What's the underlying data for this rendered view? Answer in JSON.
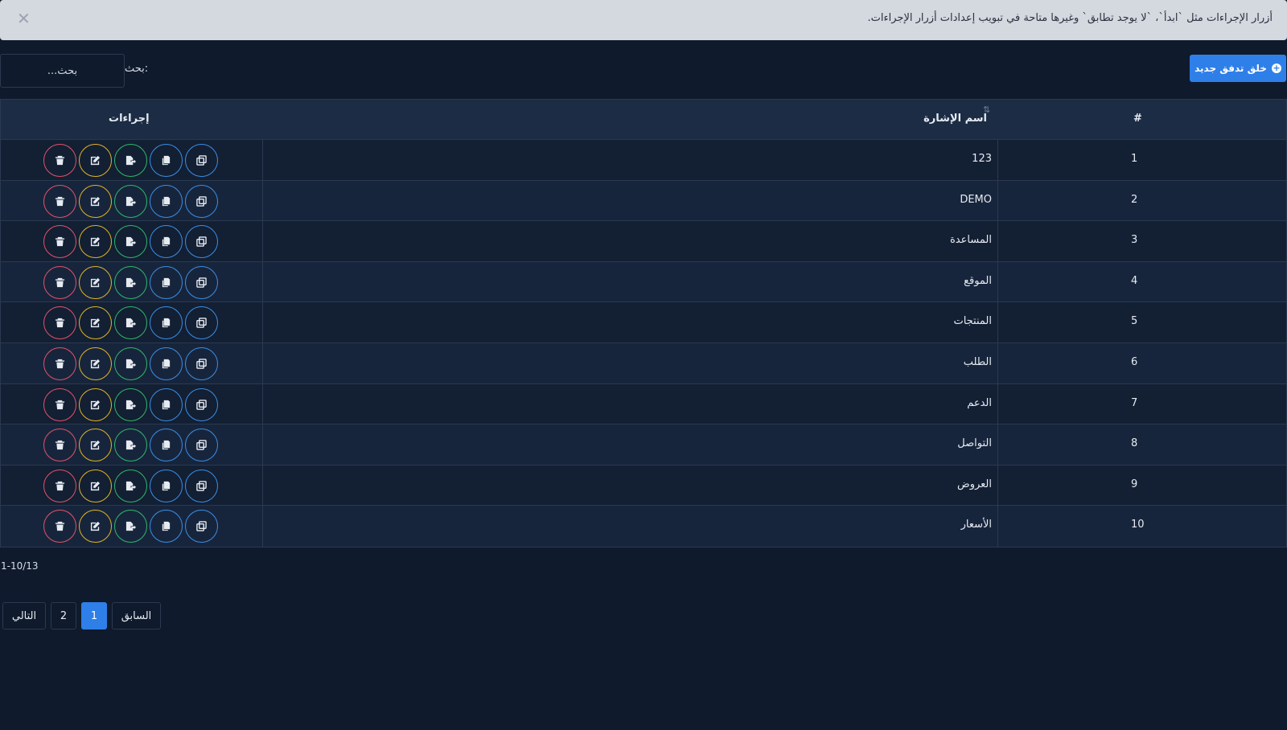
{
  "alert": {
    "text": "أزرار الإجراءات مثل `ابدأ`، `لا يوجد تطابق` وغيرها متاحة في تبويب إعدادات أزرار الإجراءات.",
    "close": "✕"
  },
  "toolbar": {
    "create_label": "خلق تدفق جديد",
    "search_label": "بحث:",
    "search_placeholder": "بحث..."
  },
  "table": {
    "headers": {
      "num": "#",
      "name": "اسم الإشارة",
      "actions": "إجراءات"
    },
    "rows": [
      {
        "num": "1",
        "name": "123"
      },
      {
        "num": "2",
        "name": "DEMO"
      },
      {
        "num": "3",
        "name": "المساعدة"
      },
      {
        "num": "4",
        "name": "الموقع"
      },
      {
        "num": "5",
        "name": "المنتجات"
      },
      {
        "num": "6",
        "name": "الطلب"
      },
      {
        "num": "7",
        "name": "الدعم"
      },
      {
        "num": "8",
        "name": "التواصل"
      },
      {
        "num": "9",
        "name": "العروض"
      },
      {
        "num": "10",
        "name": "الأسعار"
      }
    ],
    "actions": [
      "delete-icon",
      "edit-icon",
      "export-icon",
      "copy-icon",
      "duplicate-icon"
    ]
  },
  "info": "1-10/13",
  "pagination": {
    "next": "التالي",
    "pages": [
      "2",
      "1"
    ],
    "active": "1",
    "prev": "السابق"
  },
  "colors": {
    "accent": "#2f7fe8",
    "delete": "#e0536a",
    "edit": "#e0b428",
    "export": "#2fb86a",
    "copy": "#3a8ee6"
  }
}
